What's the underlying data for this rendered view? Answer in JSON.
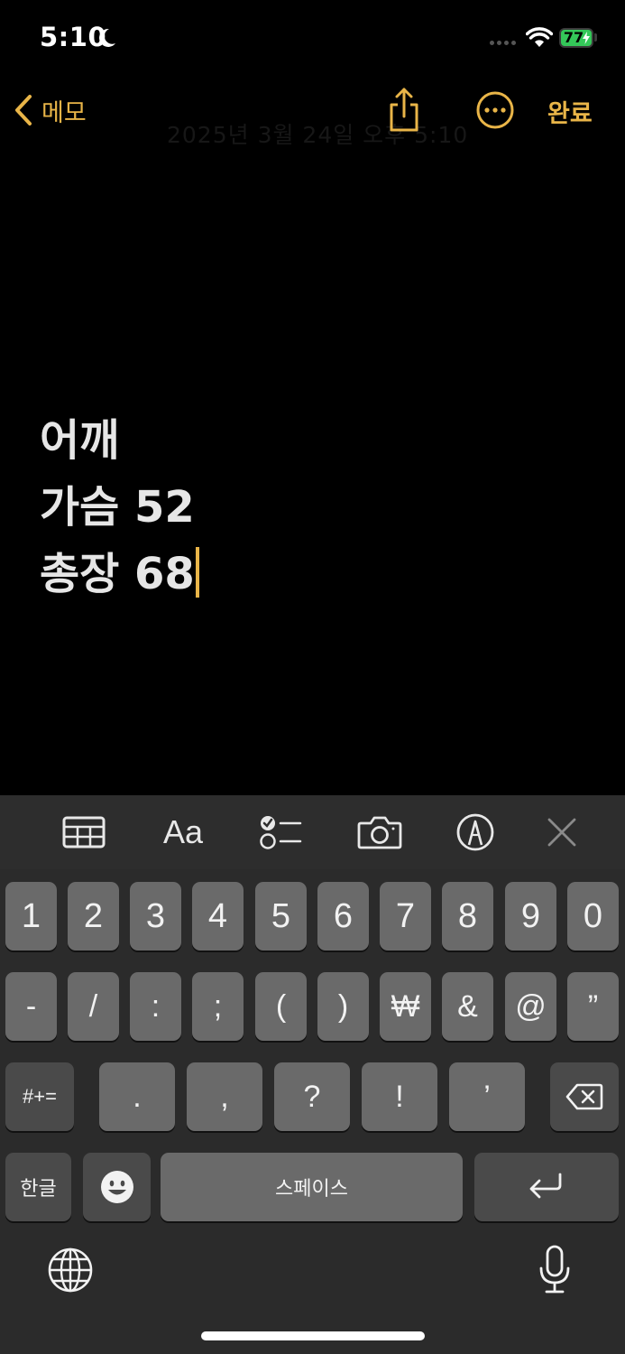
{
  "status": {
    "time": "5:10",
    "battery": "77"
  },
  "nav": {
    "back_label": "메모",
    "done_label": "완료",
    "date_ghost": "2025년 3월 24일 오후 5:10"
  },
  "note": {
    "lines": [
      "어깨",
      "가슴 52",
      "총장 68"
    ]
  },
  "toolbar": {
    "format_label": "Aa"
  },
  "keyboard": {
    "row1": [
      "1",
      "2",
      "3",
      "4",
      "5",
      "6",
      "7",
      "8",
      "9",
      "0"
    ],
    "row2": [
      "-",
      "/",
      ":",
      ";",
      "(",
      ")",
      "₩",
      "&",
      "@",
      "”"
    ],
    "row3": {
      "shift_label": "#+=",
      "keys": [
        ".",
        ",",
        "?",
        "!",
        "’"
      ]
    },
    "row4": {
      "lang_label": "한글",
      "space_label": "스페이스"
    }
  },
  "colors": {
    "accent": "#e9b548",
    "battery": "#34c759"
  }
}
